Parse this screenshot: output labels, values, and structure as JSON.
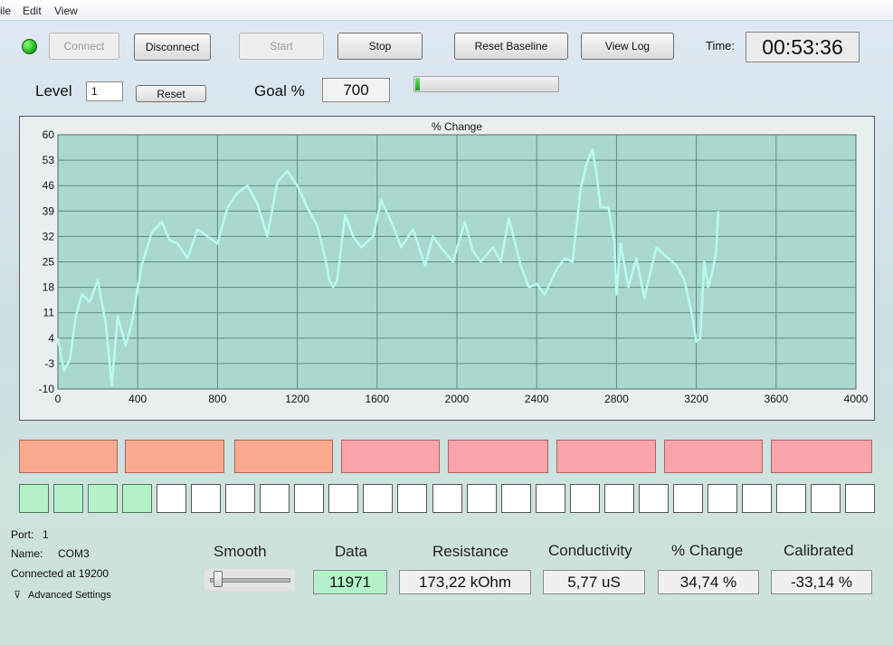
{
  "menu": [
    "ile",
    "Edit",
    "View"
  ],
  "toolbar": {
    "connect": "Connect",
    "disconnect": "Disconnect",
    "start": "Start",
    "stop": "Stop",
    "reset_baseline": "Reset Baseline",
    "view_log": "View Log",
    "time_label": "Time:",
    "time_value": "00:53:36"
  },
  "level": {
    "label": "Level",
    "value": "1",
    "reset_label": "Reset"
  },
  "goal": {
    "label": "Goal %",
    "value": "700",
    "progress_fraction": 0.03
  },
  "status_colors": {
    "connected": "#1fb31a",
    "indicator_salmon": "#fbaa91",
    "indicator_pink": "#fba3ab",
    "square_on": "#b4f3c9"
  },
  "chart_data": {
    "type": "line",
    "title": "% Change",
    "xlim": [
      0,
      4000
    ],
    "ylim": [
      -10,
      60
    ],
    "xticks": [
      0,
      400,
      800,
      1200,
      1600,
      2000,
      2400,
      2800,
      3200,
      3600,
      4000
    ],
    "yticks": [
      60,
      53,
      46,
      39,
      32,
      25,
      18,
      11,
      4,
      -3,
      -10
    ],
    "grid": true,
    "plot_bg": "#aad8ce",
    "line_color": "#b8fbf0",
    "series": [
      {
        "x": [
          0,
          30,
          60,
          90,
          120,
          160,
          200,
          240,
          270,
          300,
          340,
          370,
          420,
          470,
          520,
          560,
          600,
          650,
          700,
          750,
          800,
          850,
          900,
          950,
          1000,
          1050,
          1100,
          1150,
          1200,
          1250,
          1300,
          1340,
          1360,
          1380,
          1400,
          1440,
          1480,
          1520,
          1580,
          1620,
          1680,
          1720,
          1780,
          1840,
          1880,
          1920,
          1980,
          2040,
          2080,
          2120,
          2180,
          2220,
          2260,
          2320,
          2360,
          2400,
          2440,
          2500,
          2540,
          2580,
          2620,
          2650,
          2680,
          2700,
          2720,
          2760,
          2790,
          2800,
          2820,
          2860,
          2900,
          2940,
          2960,
          3000,
          3040,
          3100,
          3140,
          3180,
          3200,
          3220,
          3240,
          3260,
          3280,
          3300,
          3310
        ],
        "y": [
          4,
          -5,
          -2,
          10,
          16,
          14,
          20,
          8,
          -9,
          10,
          2,
          8,
          24,
          33,
          36,
          31,
          30,
          26,
          34,
          32,
          30,
          40,
          44,
          46,
          41,
          32,
          47,
          50,
          46,
          40,
          35,
          26,
          20,
          18,
          20,
          38,
          32,
          29,
          32,
          42,
          35,
          29,
          34,
          24,
          32,
          29,
          25,
          36,
          28,
          25,
          29,
          25,
          37,
          24,
          18,
          19,
          16,
          23,
          26,
          25,
          45,
          52,
          56,
          49,
          40,
          40,
          30,
          16,
          30,
          18,
          26,
          15,
          20,
          29,
          27,
          24,
          20,
          10,
          3,
          4,
          25,
          18,
          22,
          28,
          39
        ]
      }
    ]
  },
  "indicators": [
    "salmon",
    "salmon",
    "salmon",
    "pink",
    "pink",
    "pink",
    "pink",
    "pink"
  ],
  "squares": {
    "total": 25,
    "lit": 4
  },
  "port": {
    "port_label": "Port:",
    "port_value": "1",
    "name_label": "Name:",
    "name_value": "COM3",
    "connected_text": "Connected at 19200",
    "advanced": "Advanced Settings"
  },
  "smooth": {
    "label": "Smooth",
    "value_fraction": 0.05
  },
  "readouts": {
    "data_label": "Data",
    "data_value": "11971",
    "resistance_label": "Resistance",
    "resistance_value": "173,22 kOhm",
    "conductivity_label": "Conductivity",
    "conductivity_value": "5,77 uS",
    "change_label": "% Change",
    "change_value": "34,74 %",
    "calibrated_label": "Calibrated",
    "calibrated_value": "-33,14 %"
  }
}
